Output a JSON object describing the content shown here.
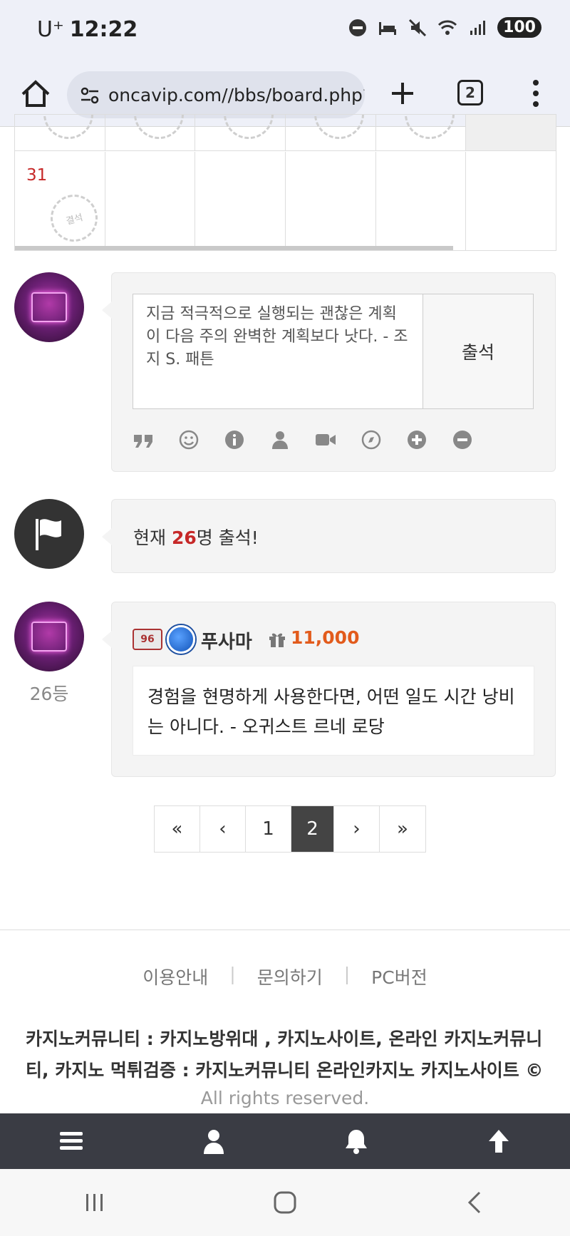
{
  "status_bar": {
    "carrier": "U⁺",
    "time": "12:22",
    "battery": "100"
  },
  "browser": {
    "url": "oncavip.com//bbs/board.php?",
    "tab_count": "2"
  },
  "calendar": {
    "day": "31",
    "stamp_label": "결석"
  },
  "attendance_form": {
    "message": "지금 적극적으로 실행되는 괜찮은 계획이 다음 주의 완벽한 계획보다 낫다. - 조지 S. 패튼",
    "submit_label": "출석",
    "toolbar_icons": [
      "quote-icon",
      "smile-icon",
      "info-icon",
      "user-icon",
      "video-icon",
      "compass-icon",
      "plus-circle-icon",
      "minus-circle-icon"
    ]
  },
  "attendance_count": {
    "prefix": "현재 ",
    "count": "26",
    "suffix": "명 출석!"
  },
  "post": {
    "rank": "26등",
    "level": "96",
    "username": "푸사마",
    "points": "11,000",
    "body": "경험을 현명하게 사용한다면, 어떤 일도 시간 낭비는 아니다. - 오귀스트 르네 로당"
  },
  "pagination": {
    "first": "«",
    "prev": "‹",
    "page1": "1",
    "page2": "2",
    "next": "›",
    "last": "»"
  },
  "footer": {
    "link_guide": "이용안내",
    "link_inquiry": "문의하기",
    "link_pc": "PC버전",
    "description": "카지노커뮤니티 : 카지노방위대 , 카지노사이트, 온라인 카지노커뮤니티, 카지노 먹튀검증 : 카지노커뮤니티 온라인카지노 카지노사이트 ©",
    "rights": "All rights reserved."
  }
}
